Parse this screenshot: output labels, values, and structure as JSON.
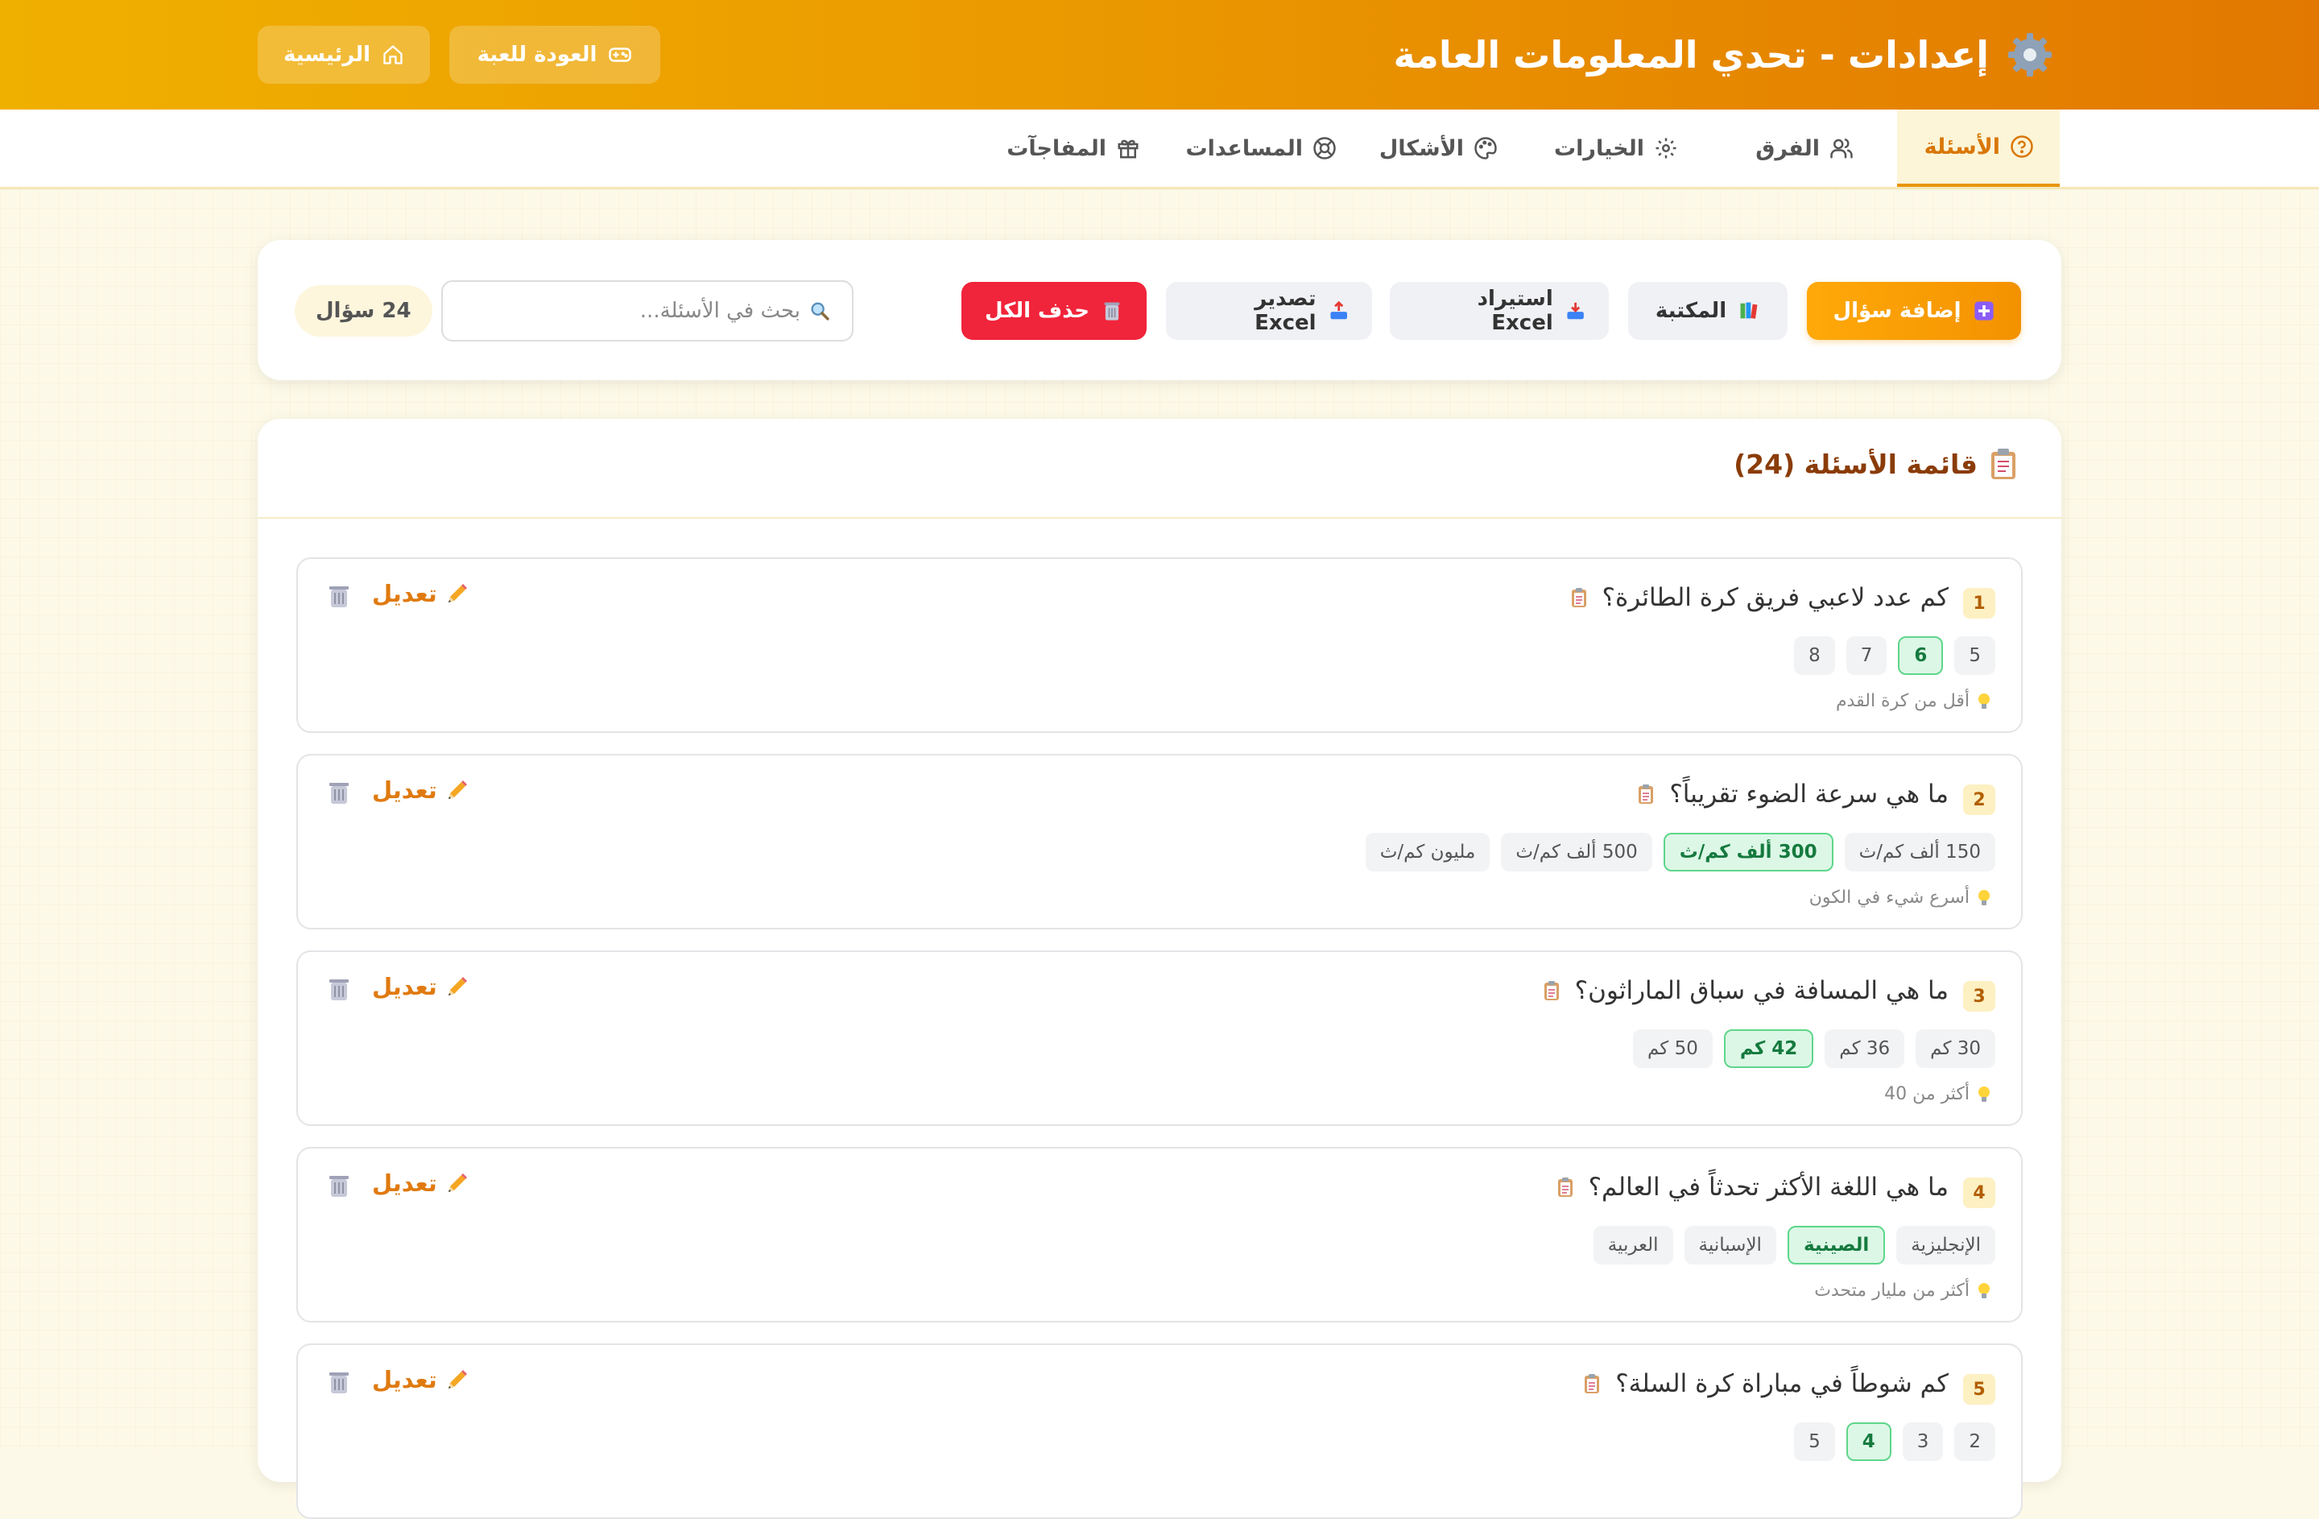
{
  "header": {
    "title": "إعدادات - تحدي المعلومات العامة",
    "back_to_game": "العودة للعبة",
    "home": "الرئيسية"
  },
  "tabs": [
    {
      "label": "الأسئلة",
      "icon": "help-circle-icon",
      "active": true
    },
    {
      "label": "الفرق",
      "icon": "users-icon"
    },
    {
      "label": "الخيارات",
      "icon": "gear-icon"
    },
    {
      "label": "الأشكال",
      "icon": "palette-icon"
    },
    {
      "label": "المساعدات",
      "icon": "lifebuoy-icon"
    },
    {
      "label": "المفاجآت",
      "icon": "gift-icon"
    }
  ],
  "toolbar": {
    "add_question": "إضافة سؤال",
    "library": "المكتبة",
    "import_excel": "استيراد Excel",
    "export_excel": "تصدير Excel",
    "delete_all": "حذف الكل",
    "search_placeholder": "بحث في الأسئلة...",
    "count": "24 سؤال"
  },
  "list": {
    "title": "قائمة الأسئلة (24)",
    "edit_label": "تعديل",
    "questions": [
      {
        "num": "1",
        "text": "كم عدد لاعبي فريق كرة الطائرة؟",
        "options": [
          "5",
          "6",
          "7",
          "8"
        ],
        "correct": 1,
        "hint": "أقل من كرة القدم"
      },
      {
        "num": "2",
        "text": "ما هي سرعة الضوء تقريباً؟",
        "options": [
          "150 ألف كم/ث",
          "300 ألف كم/ث",
          "500 ألف كم/ث",
          "مليون كم/ث"
        ],
        "correct": 1,
        "hint": "أسرع شيء في الكون"
      },
      {
        "num": "3",
        "text": "ما هي المسافة في سباق الماراثون؟",
        "options": [
          "30 كم",
          "36 كم",
          "42 كم",
          "50 كم"
        ],
        "correct": 2,
        "hint": "أكثر من 40"
      },
      {
        "num": "4",
        "text": "ما هي اللغة الأكثر تحدثاً في العالم؟",
        "options": [
          "الإنجليزية",
          "الصينية",
          "الإسبانية",
          "العربية"
        ],
        "correct": 1,
        "hint": "أكثر من مليار متحدث"
      },
      {
        "num": "5",
        "text": "كم شوطاً في مباراة كرة السلة؟",
        "options": [
          "2",
          "3",
          "4",
          "5"
        ],
        "correct": 2,
        "hint": ""
      }
    ]
  },
  "colors": {
    "header_start": "#f0b000",
    "header_end": "#e27800",
    "accent": "#e8960c",
    "danger": "#f0243a",
    "correct": "#157a3e"
  }
}
